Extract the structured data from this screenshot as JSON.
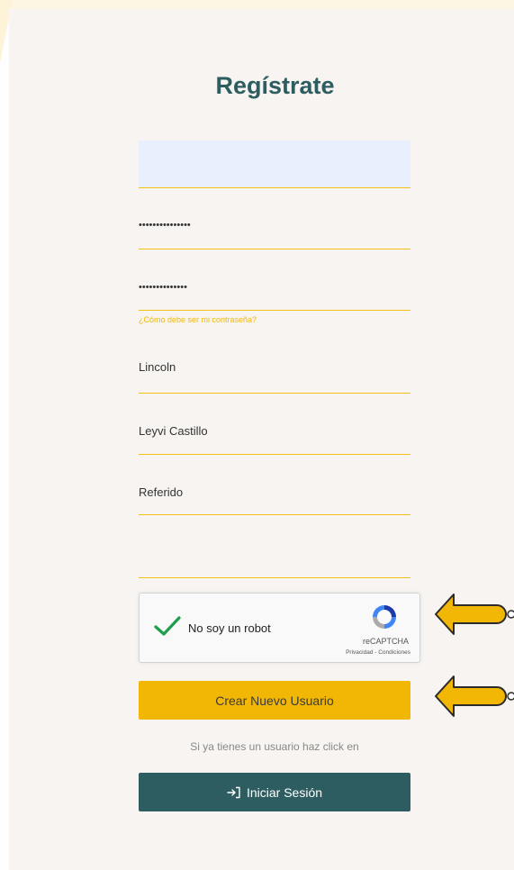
{
  "page": {
    "title": "Regístrate"
  },
  "form": {
    "email": {
      "value": "",
      "placeholder": ""
    },
    "password": {
      "value": "•••••••••••••••"
    },
    "password_confirm": {
      "value": "••••••••••••••"
    },
    "password_hint": "¿Cómo debe ser mi contraseña?",
    "first_name": {
      "value": "Lincoln"
    },
    "last_name": {
      "value": "Leyvi Castillo"
    },
    "referral": {
      "value": "Referido"
    },
    "extra": {
      "value": ""
    }
  },
  "captcha": {
    "label": "No soy un robot",
    "brand": "reCAPTCHA",
    "legal": "Privacidad - Condiciones",
    "checked": true
  },
  "actions": {
    "create_label": "Crear Nuevo Usuario",
    "login_prompt": "Si ya tienes un usuario haz click en",
    "login_label": "Iniciar Sesión"
  },
  "icons": {
    "captcha_check": "checkmark-icon",
    "captcha_logo": "recaptcha-logo-icon",
    "login": "sign-in-icon",
    "arrow": "arrow-left-icon"
  },
  "colors": {
    "primary": "#2d5d60",
    "accent": "#f2b705",
    "field_line": "#f2c21b",
    "card_bg": "#f7f4f1",
    "check": "#1e9d4c",
    "autofill": "#e8f0fe"
  }
}
